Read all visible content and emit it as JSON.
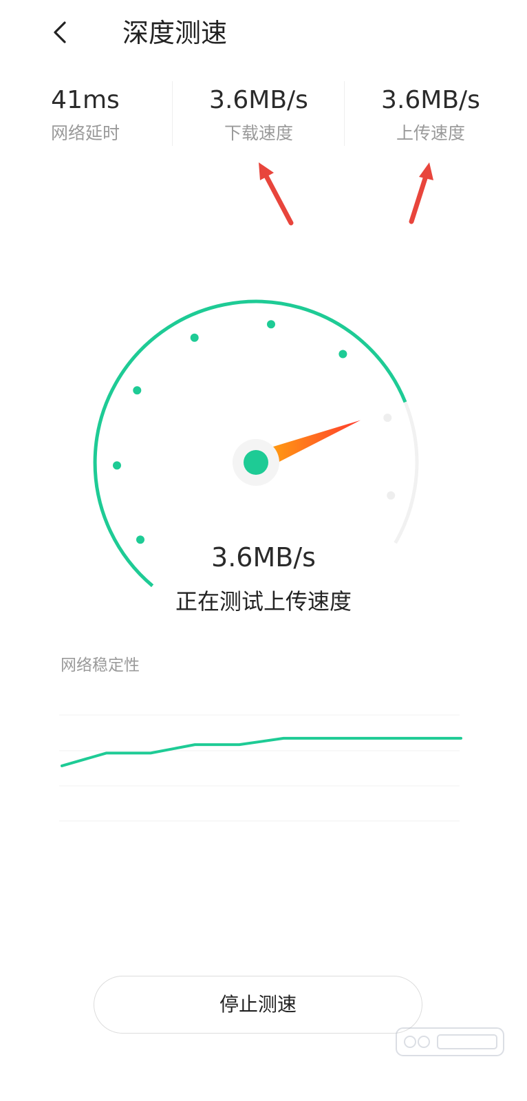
{
  "header": {
    "title": "深度测速",
    "back_icon": "chevron-left-icon"
  },
  "stats": [
    {
      "value": "41ms",
      "label": "网络延时"
    },
    {
      "value": "3.6MB/s",
      "label": "下载速度"
    },
    {
      "value": "3.6MB/s",
      "label": "上传速度"
    }
  ],
  "gauge": {
    "value": "3.6MB/s",
    "status": "正在测试上传速度",
    "progress": 0.8,
    "ticks": 8,
    "accent_color": "#1ecb95",
    "track_color": "#f1f1f1",
    "needle_colors": [
      "#ff9a12",
      "#ff3b2e"
    ]
  },
  "stability": {
    "title": "网络稳定性",
    "line_color": "#1ecb95",
    "points": [
      0.52,
      0.64,
      0.64,
      0.72,
      0.72,
      0.78,
      0.78,
      0.78,
      0.78,
      0.78
    ]
  },
  "actions": {
    "stop_label": "停止测速"
  },
  "annotations": {
    "arrow_color": "#e8453c"
  }
}
